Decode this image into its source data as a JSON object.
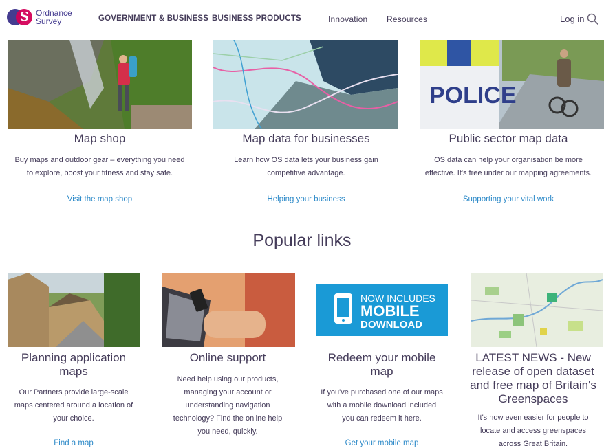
{
  "header": {
    "logo_line1": "Ordnance",
    "logo_line2": "Survey",
    "nav": [
      "GOVERNMENT & BUSINESS",
      "BUSINESS PRODUCTS",
      "Innovation",
      "Resources"
    ],
    "login": "Log in"
  },
  "top_cards": [
    {
      "title": "Map shop",
      "desc1": "Buy maps and outdoor gear – everything you need",
      "desc2": "to explore, boost your fitness and stay safe.",
      "link": "Visit the map shop"
    },
    {
      "title": "Map data for businesses",
      "desc1": "Learn how OS data lets your business gain",
      "desc2": "competitive advantage.",
      "link": "Helping your business"
    },
    {
      "title": "Public sector map data",
      "desc1": "OS data can help your organisation be more",
      "desc2": "effective. It's free under our mapping agreements.",
      "link": "Supporting your vital work"
    }
  ],
  "police_text": "POLICE",
  "popular_title": "Popular links",
  "popular": [
    {
      "title1": "Planning application",
      "title2": "maps",
      "desc": [
        "Our Partners provide large-scale",
        "maps centered around a location of",
        "your choice."
      ],
      "link": "Find a map"
    },
    {
      "title1": "Online support",
      "desc": [
        "Need help using our products,",
        "managing your account or",
        "understanding navigation",
        "technology? Find the online help",
        "you need, quickly."
      ]
    },
    {
      "title1": "Redeem your mobile",
      "title2": "map",
      "desc": [
        "If you've purchased one of our maps",
        "with a mobile download included",
        "you can redeem it here."
      ],
      "link": "Get your mobile map",
      "banner": {
        "line1": "NOW INCLUDES",
        "line2": "MOBILE",
        "line3": "DOWNLOAD"
      }
    },
    {
      "title_lines": [
        "LATEST NEWS - New",
        "release of open dataset",
        "and free map of Britain's",
        "Greenspaces"
      ],
      "desc": [
        "It's now even easier for people to",
        "locate and access greenspaces",
        "across Great Britain."
      ]
    }
  ],
  "colors": {
    "text": "#453c5a",
    "link": "#2f8bc9",
    "banner": "#1a9ad6",
    "brand_purple": "#453c90",
    "brand_pink": "#d40058"
  }
}
